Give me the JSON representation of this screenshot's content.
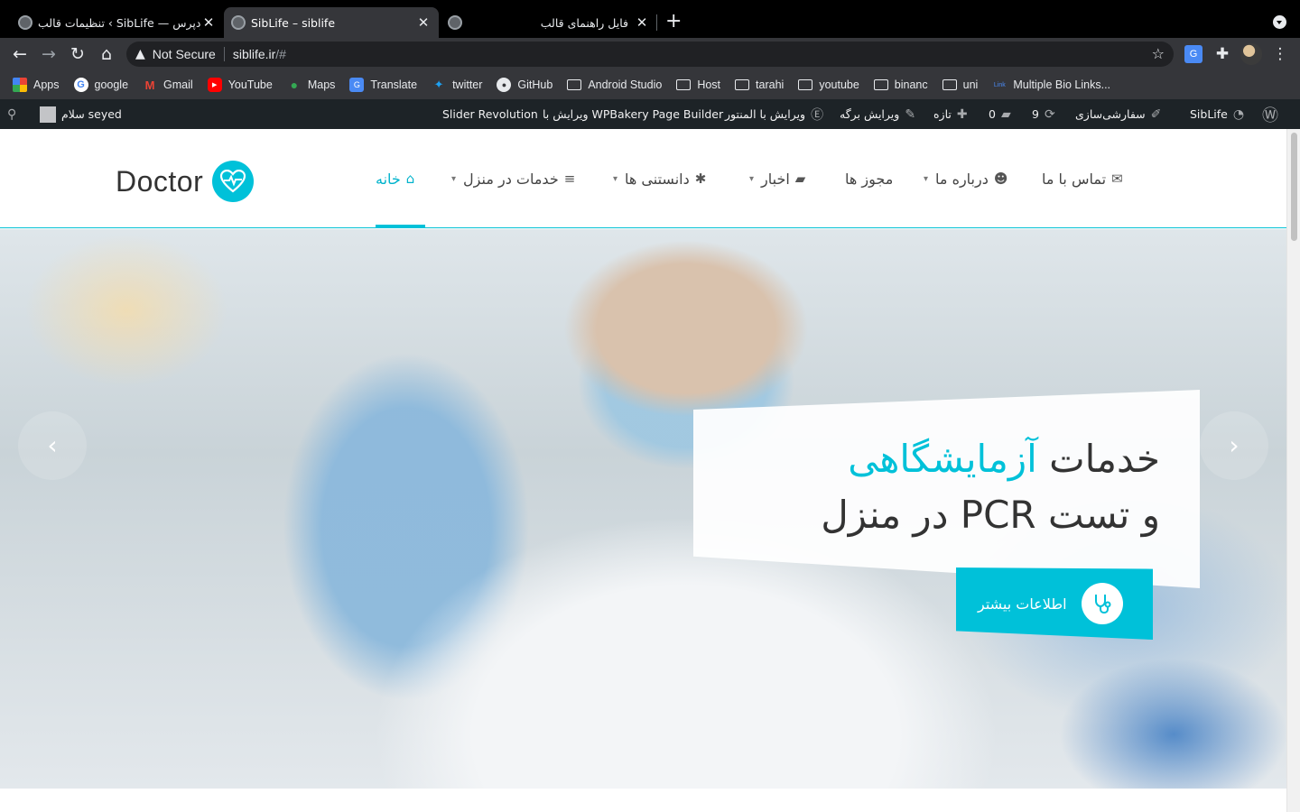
{
  "browser": {
    "tabs": [
      {
        "title": "تنظیمات قالب ‹ SibLife — وردپرس",
        "close": "✕"
      },
      {
        "title": "SibLife – siblife",
        "close": "✕"
      },
      {
        "title": "فایل راهنمای قالب",
        "close": "✕"
      }
    ],
    "new_tab": "+",
    "omnibox": {
      "security_label": "Not Secure",
      "url_host": "siblife.ir",
      "url_path": "/#"
    },
    "bookmarks": [
      {
        "label": "Apps",
        "icon": "apps-grid-icon"
      },
      {
        "label": "google",
        "icon": "google-icon"
      },
      {
        "label": "Gmail",
        "icon": "gmail-icon"
      },
      {
        "label": "YouTube",
        "icon": "youtube-icon"
      },
      {
        "label": "Maps",
        "icon": "maps-icon"
      },
      {
        "label": "Translate",
        "icon": "translate-icon"
      },
      {
        "label": "twitter",
        "icon": "twitter-icon"
      },
      {
        "label": "GitHub",
        "icon": "github-icon"
      },
      {
        "label": "Android Studio",
        "icon": "folder-icon"
      },
      {
        "label": "Host",
        "icon": "folder-icon"
      },
      {
        "label": "tarahi",
        "icon": "folder-icon"
      },
      {
        "label": "youtube",
        "icon": "folder-icon"
      },
      {
        "label": "binanc",
        "icon": "folder-icon"
      },
      {
        "label": "uni",
        "icon": "folder-icon"
      },
      {
        "label": "Multiple Bio Links...",
        "icon": "link-icon"
      }
    ]
  },
  "adminbar": {
    "greeting": "سلام seyed",
    "slider_revolution": "Slider Revolution",
    "wpbakery": "ویرایش با WPBakery Page Builder",
    "elementor": "ویرایش با المنتور",
    "edit_page": "ویرایش برگه",
    "new": "تازه",
    "comments_count": "0",
    "updates_count": "9",
    "customize": "سفارشی‌سازی",
    "site_name": "SibLife"
  },
  "site": {
    "logo_text": "Doctor",
    "menu": [
      {
        "label": "خانه",
        "icon": "home-icon",
        "active": true,
        "has_submenu": false
      },
      {
        "label": "خدمات در منزل",
        "icon": "bars-icon",
        "active": false,
        "has_submenu": true
      },
      {
        "label": "دانستنی ها",
        "icon": "asterisk-icon",
        "active": false,
        "has_submenu": true
      },
      {
        "label": "اخبار",
        "icon": "comments-icon",
        "active": false,
        "has_submenu": true
      },
      {
        "label": "مجوز ها",
        "icon": "",
        "active": false,
        "has_submenu": false
      },
      {
        "label": "درباره ما",
        "icon": "users-icon",
        "active": false,
        "has_submenu": true
      },
      {
        "label": "تماس با ما",
        "icon": "envelope-icon",
        "active": false,
        "has_submenu": false
      }
    ],
    "accent_color": "#00c1d9"
  },
  "hero": {
    "title_plain": "خدمات ",
    "title_accent": "آزمایشگاهی",
    "subtitle": "و تست PCR در منزل",
    "cta_label": "اطلاعات بیشتر",
    "prev_arrow": "‹",
    "next_arrow": "›"
  }
}
